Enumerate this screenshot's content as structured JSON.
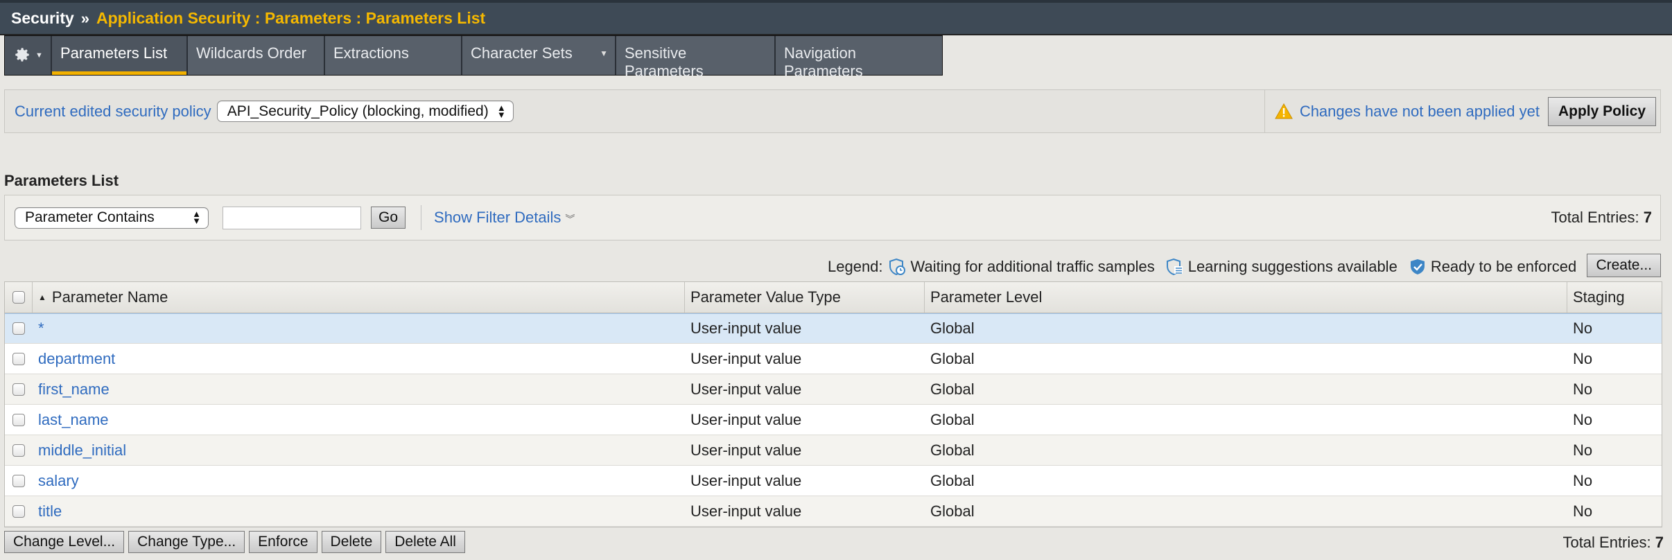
{
  "breadcrumb": {
    "root": "Security",
    "separator": "»",
    "path": "Application Security : Parameters : Parameters List"
  },
  "tabs": [
    {
      "label": "Parameters List",
      "active": true
    },
    {
      "label": "Wildcards Order",
      "active": false
    },
    {
      "label": "Extractions",
      "active": false
    },
    {
      "label": "Character Sets",
      "active": false
    },
    {
      "label": "Sensitive Parameters",
      "active": false
    },
    {
      "label": "Navigation Parameters",
      "active": false
    }
  ],
  "policy": {
    "label": "Current edited security policy",
    "selected": "API_Security_Policy (blocking, modified)",
    "notice": "Changes have not been applied yet",
    "apply_label": "Apply Policy"
  },
  "section_title": "Parameters List",
  "filter": {
    "selected": "Parameter Contains",
    "input_value": "",
    "go_label": "Go",
    "details_link": "Show Filter Details",
    "total_label": "Total Entries:",
    "total_value": "7"
  },
  "legend": {
    "label": "Legend:",
    "items": [
      {
        "icon": "shield-clock-icon",
        "text": "Waiting for additional traffic samples"
      },
      {
        "icon": "shield-list-icon",
        "text": "Learning suggestions available"
      },
      {
        "icon": "shield-check-icon",
        "text": "Ready to be enforced"
      }
    ],
    "create_label": "Create..."
  },
  "table": {
    "columns": [
      "Parameter Name",
      "Parameter Value Type",
      "Parameter Level",
      "Staging"
    ],
    "rows": [
      {
        "name": "*",
        "value_type": "User-input value",
        "level": "Global",
        "staging": "No"
      },
      {
        "name": "department",
        "value_type": "User-input value",
        "level": "Global",
        "staging": "No"
      },
      {
        "name": "first_name",
        "value_type": "User-input value",
        "level": "Global",
        "staging": "No"
      },
      {
        "name": "last_name",
        "value_type": "User-input value",
        "level": "Global",
        "staging": "No"
      },
      {
        "name": "middle_initial",
        "value_type": "User-input value",
        "level": "Global",
        "staging": "No"
      },
      {
        "name": "salary",
        "value_type": "User-input value",
        "level": "Global",
        "staging": "No"
      },
      {
        "name": "title",
        "value_type": "User-input value",
        "level": "Global",
        "staging": "No"
      }
    ]
  },
  "actions": [
    "Change Level...",
    "Change Type...",
    "Enforce",
    "Delete",
    "Delete All"
  ],
  "colors": {
    "titlebar": "#3e4a56",
    "breadcrumb_accent": "#f5b800",
    "tab_accent": "#f2b100",
    "link": "#2f6bbf",
    "selected_row": "#d9e8f6"
  }
}
